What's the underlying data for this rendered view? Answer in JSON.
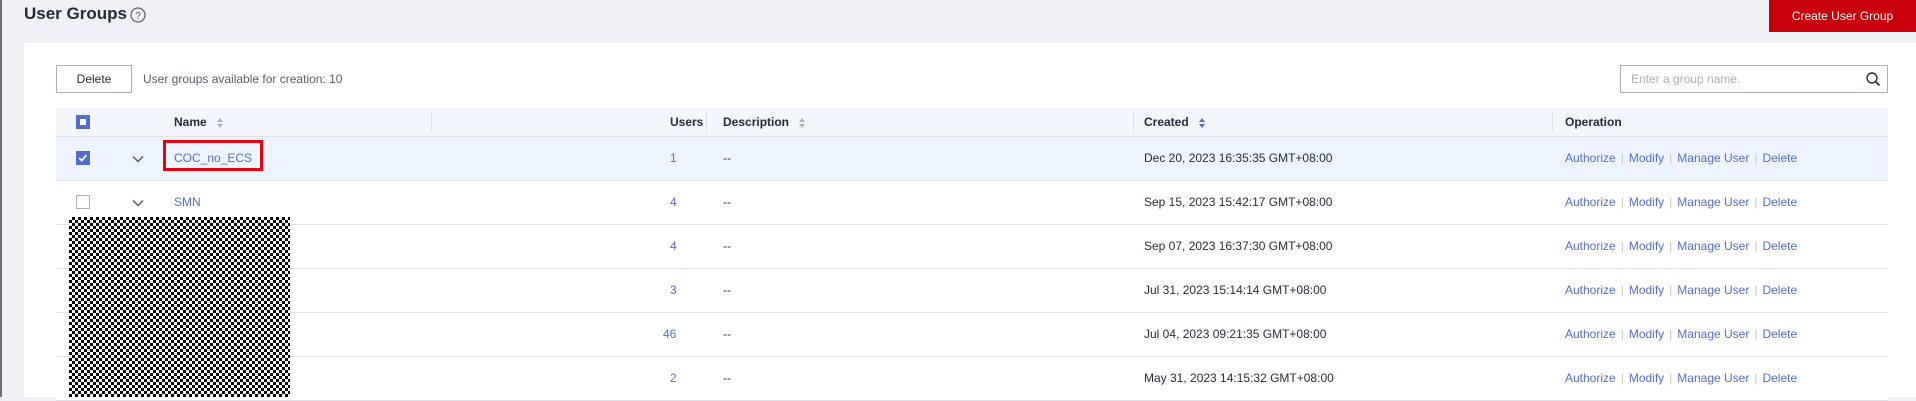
{
  "page": {
    "title": "User Groups",
    "create_button": "Create User Group"
  },
  "toolbar": {
    "delete_label": "Delete",
    "availability_text": "User groups available for creation: 10",
    "search_placeholder": "Enter a group name."
  },
  "table": {
    "columns": {
      "name": "Name",
      "users": "Users",
      "description": "Description",
      "created": "Created",
      "operation": "Operation"
    },
    "header_checkbox_state": "partial",
    "rows": [
      {
        "name": "COC_no_ECS",
        "users": "1",
        "description": "--",
        "created": "Dec 20, 2023 16:35:35 GMT+08:00",
        "checked": true,
        "highlighted": true
      },
      {
        "name": "SMN",
        "users": "4",
        "description": "--",
        "created": "Sep 15, 2023 15:42:17 GMT+08:00",
        "checked": false,
        "highlighted": false
      },
      {
        "name": "",
        "users": "4",
        "description": "--",
        "created": "Sep 07, 2023 16:37:30 GMT+08:00",
        "checked": false,
        "highlighted": false
      },
      {
        "name": "",
        "users": "3",
        "description": "--",
        "created": "Jul 31, 2023 15:14:14 GMT+08:00",
        "checked": false,
        "highlighted": false
      },
      {
        "name": "",
        "users": "46",
        "description": "--",
        "created": "Jul 04, 2023 09:21:35 GMT+08:00",
        "checked": false,
        "highlighted": false
      },
      {
        "name": "",
        "users": "2",
        "description": "--",
        "created": "May 31, 2023 14:15:32 GMT+08:00",
        "checked": false,
        "highlighted": false
      }
    ],
    "operations": {
      "authorize": "Authorize",
      "modify": "Modify",
      "manage_user": "Manage User",
      "delete": "Delete"
    }
  },
  "colors": {
    "primary_red": "#c7000b",
    "link_blue": "#526ecc",
    "selected_row": "#eef4ff",
    "annotation_red": "#e5000f"
  },
  "icons": {
    "help": "help-circle-icon",
    "search": "search-icon",
    "sort": "sort-icon",
    "expand": "chevron-down-icon"
  }
}
